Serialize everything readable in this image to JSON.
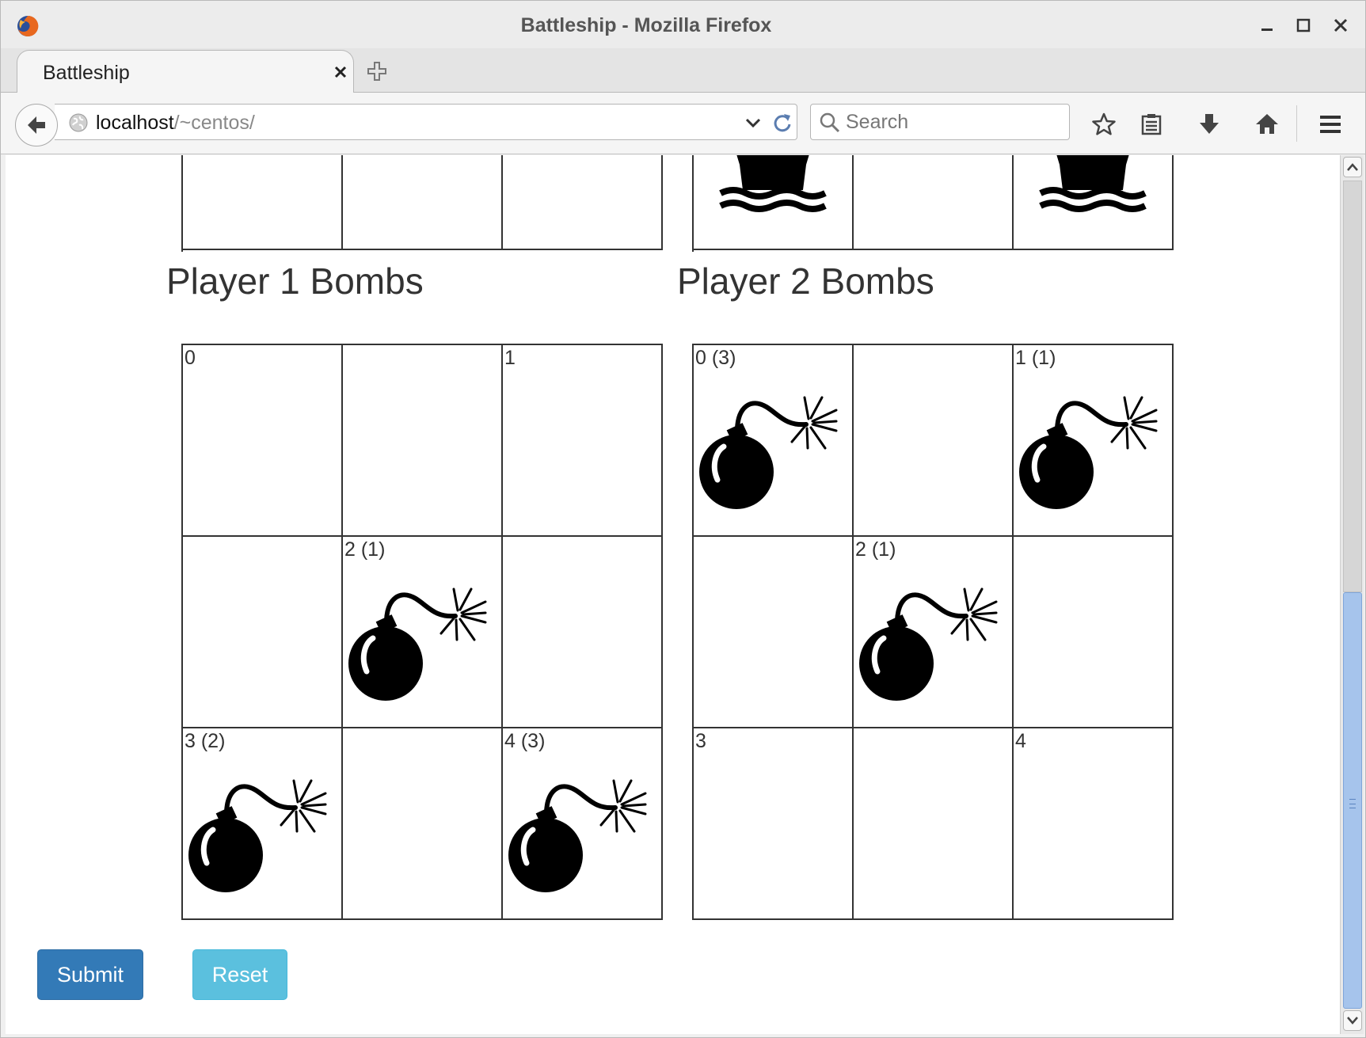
{
  "window": {
    "title": "Battleship - Mozilla Firefox"
  },
  "tab": {
    "label": "Battleship"
  },
  "navbar": {
    "url_host": "localhost",
    "url_path": "/~centos/",
    "search_placeholder": "Search"
  },
  "icons": {
    "app": "firefox-logo-icon",
    "ship": "ship-icon",
    "bomb": "bomb-icon"
  },
  "colors": {
    "submit": "#337ab7",
    "reset": "#5bc0de",
    "scroll_thumb": "#a6c4ec"
  },
  "ship_boards": [
    {
      "cells": [
        {
          "label": "",
          "ship": false
        },
        {
          "label": "",
          "ship": false
        },
        {
          "label": "",
          "ship": false
        }
      ]
    },
    {
      "cells": [
        {
          "label": "",
          "ship": true
        },
        {
          "label": "",
          "ship": false
        },
        {
          "label": "",
          "ship": true
        }
      ]
    }
  ],
  "bomb_boards": [
    {
      "title": "Player 1 Bombs",
      "cells": [
        {
          "label": "0",
          "bomb": false
        },
        {
          "label": "",
          "bomb": false
        },
        {
          "label": "1",
          "bomb": false
        },
        {
          "label": "",
          "bomb": false
        },
        {
          "label": "2 (1)",
          "bomb": true
        },
        {
          "label": "",
          "bomb": false
        },
        {
          "label": "3 (2)",
          "bomb": true
        },
        {
          "label": "",
          "bomb": false
        },
        {
          "label": "4 (3)",
          "bomb": true
        }
      ]
    },
    {
      "title": "Player 2 Bombs",
      "cells": [
        {
          "label": "0 (3)",
          "bomb": true
        },
        {
          "label": "",
          "bomb": false
        },
        {
          "label": "1 (1)",
          "bomb": true
        },
        {
          "label": "",
          "bomb": false
        },
        {
          "label": "2 (1)",
          "bomb": true
        },
        {
          "label": "",
          "bomb": false
        },
        {
          "label": "3",
          "bomb": false
        },
        {
          "label": "",
          "bomb": false
        },
        {
          "label": "4",
          "bomb": false
        }
      ]
    }
  ],
  "buttons": {
    "submit": "Submit",
    "reset": "Reset"
  }
}
